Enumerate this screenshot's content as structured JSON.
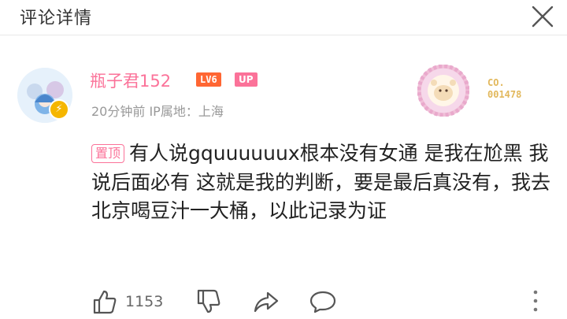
{
  "header": {
    "title": "评论详情"
  },
  "comment": {
    "username": "瓶子君152",
    "level": "LV6",
    "up_badge": "UP",
    "meta": "20分钟前 IP属地：上海",
    "fan_number_line1": "CO.",
    "fan_number_line2": "001478",
    "pin_label": "置顶",
    "text": "有人说gquuuuuux根本没有女通 是我在尬黑 我说后面必有 这就是我的判断，要是最后真没有，我去北京喝豆汁一大桶，以此记录为证"
  },
  "actions": {
    "like_count": "1153"
  },
  "colors": {
    "accent_pink": "#fb7299",
    "level_orange": "#ff6633"
  }
}
